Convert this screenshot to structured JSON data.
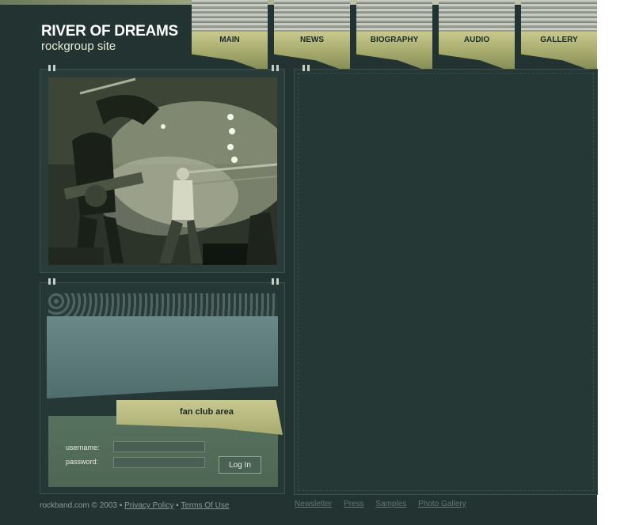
{
  "site": {
    "title": "RIVER OF DREAMS",
    "subtitle": "rockgroup site"
  },
  "nav": {
    "items": [
      {
        "label": "MAIN"
      },
      {
        "label": "NEWS"
      },
      {
        "label": "BIOGRAPHY"
      },
      {
        "label": "AUDIO"
      },
      {
        "label": "GALLERY"
      }
    ]
  },
  "fanclub": {
    "title": "fan club area",
    "username_label": "username:",
    "password_label": "password:",
    "username_value": "",
    "password_value": "",
    "login_label": "Log In"
  },
  "footer": {
    "copyright": "rockband.com © 2003",
    "separator": "▪",
    "privacy": "Privacy Policy",
    "terms": "Terms Of Use",
    "links": [
      "Newsletter",
      "Press",
      "Samples",
      "Photo Gallery"
    ]
  },
  "colors": {
    "background": "#223331",
    "accent": "#b8ba7e",
    "login_panel": "#57715f"
  }
}
